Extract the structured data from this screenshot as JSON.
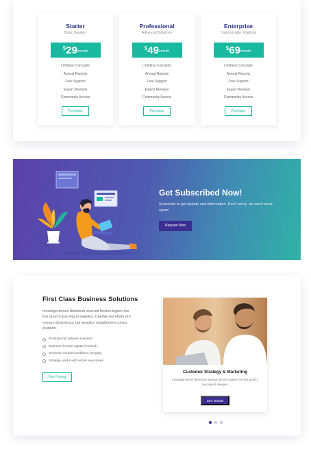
{
  "pricing": {
    "plans": [
      {
        "name": "Starter",
        "subtitle": "Basic Solution",
        "currency": "$",
        "amount": "29",
        "period": "/month",
        "features": [
          "Limitless Concepts",
          "Annual Reports",
          "Free Support",
          "Expert Reviews",
          "Community Access"
        ],
        "button": "Purchase"
      },
      {
        "name": "Professional",
        "subtitle": "Advanced Solutions",
        "currency": "$",
        "amount": "49",
        "period": "/month",
        "features": [
          "Limitless Concepts",
          "Annual Reports",
          "Free Support",
          "Expert Reviews",
          "Community Access"
        ],
        "button": "Purchase"
      },
      {
        "name": "Enterprise",
        "subtitle": "Customizable Solutions",
        "currency": "$",
        "amount": "69",
        "period": "/month",
        "features": [
          "Limitless Concepts",
          "Annual Reports",
          "Free Support",
          "Expert Reviews",
          "Community Access"
        ],
        "button": "Purchase"
      }
    ]
  },
  "subscribe": {
    "title": "Get Subscribed Now!",
    "text": "Subscribe to get update and information. Don't worry, we won't send spam!",
    "button": "Request Now"
  },
  "business": {
    "title": "First Class Business Solutions",
    "text": "Investiga tiones demonstr averunt lectres legere me lius quod ii qua legunt saepius. Claritas est etiam pro cessus dynamicus, qui sequitur mutationem consu etudium.",
    "list": [
      "Professional delivers solutions",
      "Business human capital research",
      "Services complex problems bringing",
      "Strategy works with senior executives"
    ],
    "button": "See Pricing",
    "card": {
      "title": "Customer Strategy & Marketing",
      "text": "Investiga tiones demonstr averunt lectres legere me lius quod ii qua legunt saepius.",
      "button": "See Details"
    }
  },
  "colors": {
    "accent": "#19b9a0",
    "brand": "#3b2e91",
    "title": "#2b2f8a"
  },
  "icons": [
    "check-circle-icon"
  ]
}
